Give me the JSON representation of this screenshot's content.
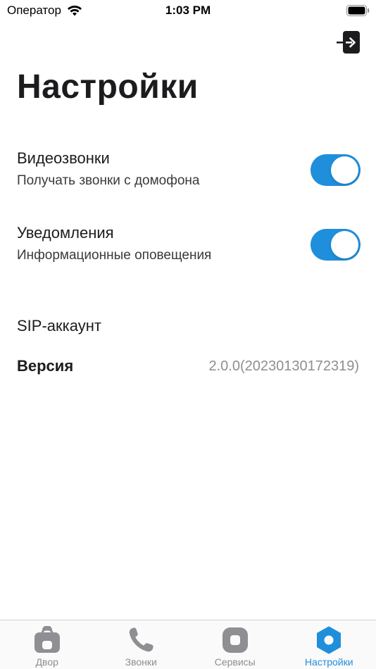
{
  "status_bar": {
    "carrier": "Оператор",
    "time": "1:03 PM"
  },
  "header": {
    "title": "Настройки",
    "logout_icon": "logout-icon"
  },
  "settings": {
    "video_calls": {
      "title": "Видеозвонки",
      "subtitle": "Получать звонки с домофона",
      "enabled": true
    },
    "notifications": {
      "title": "Уведомления",
      "subtitle": "Информационные оповещения",
      "enabled": true
    },
    "sip_account": {
      "label": "SIP-аккаунт"
    },
    "version": {
      "label": "Версия",
      "value": "2.0.0(20230130172319)"
    }
  },
  "tab_bar": {
    "tabs": [
      {
        "label": "Двор",
        "icon": "yard-icon",
        "active": false
      },
      {
        "label": "Звонки",
        "icon": "phone-icon",
        "active": false
      },
      {
        "label": "Сервисы",
        "icon": "services-icon",
        "active": false
      },
      {
        "label": "Настройки",
        "icon": "settings-hex-icon",
        "active": true
      }
    ]
  },
  "colors": {
    "accent": "#1f8fdb",
    "inactive_tab": "#8e8e93",
    "text_primary": "#1c1c1e",
    "text_secondary": "#8e8e93"
  }
}
